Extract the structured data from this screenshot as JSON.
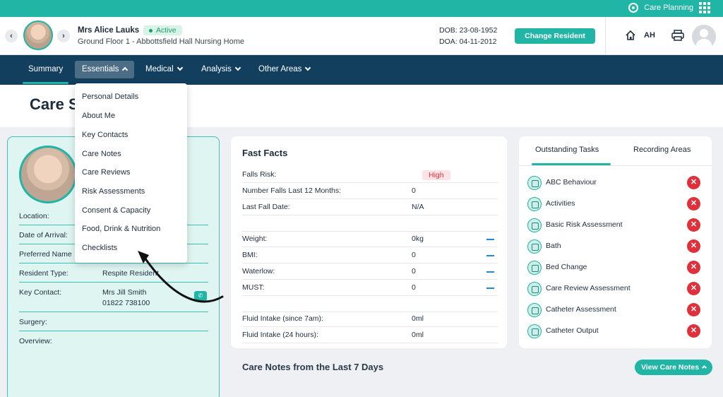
{
  "topbar": {
    "care_planning": "Care Planning"
  },
  "header": {
    "resident_name": "Mrs Alice Lauks",
    "status": "Active",
    "location": "Ground Floor 1 - Abbottsfield Hall Nursing Home",
    "dob": "DOB: 23-08-1952",
    "doa": "DOA: 04-11-2012",
    "change_button": "Change Resident",
    "user_initials": "AH"
  },
  "nav": {
    "items": [
      {
        "label": "Summary"
      },
      {
        "label": "Essentials"
      },
      {
        "label": "Medical"
      },
      {
        "label": "Analysis"
      },
      {
        "label": "Other Areas"
      }
    ]
  },
  "page": {
    "title": "Care S"
  },
  "essentials_menu": [
    "Personal Details",
    "About Me",
    "Key Contacts",
    "Care Notes",
    "Care Reviews",
    "Risk Assessments",
    "Consent & Capacity",
    "Food, Drink & Nutrition",
    "Checklists"
  ],
  "resident_card": {
    "fields": [
      {
        "label": "Location:",
        "value": ""
      },
      {
        "label": "Date of Arrival:",
        "value": ""
      },
      {
        "label": "Preferred Name",
        "value": ""
      },
      {
        "label": "Resident Type:",
        "value": "Respite Resident"
      },
      {
        "label": "Key Contact:",
        "value": "Mrs Jill Smith",
        "value2": "01822 738100"
      },
      {
        "label": "Surgery:",
        "value": ""
      },
      {
        "label": "Overview:",
        "value": ""
      }
    ]
  },
  "fast_facts": {
    "title": "Fast Facts",
    "rows": [
      {
        "label": "Falls Risk:",
        "value": "High"
      },
      {
        "label": "Number Falls Last 12 Months:",
        "value": "0"
      },
      {
        "label": "Last Fall Date:",
        "value": "N/A"
      },
      {
        "label": "Weight:",
        "value": "0kg"
      },
      {
        "label": "BMI:",
        "value": "0"
      },
      {
        "label": "Waterlow:",
        "value": "0"
      },
      {
        "label": "MUST:",
        "value": "0"
      },
      {
        "label": "Fluid Intake (since 7am):",
        "value": "0ml"
      },
      {
        "label": "Fluid Intake (24 hours):",
        "value": "0ml"
      }
    ]
  },
  "tasks": {
    "tab_outstanding": "Outstanding Tasks",
    "tab_recording": "Recording Areas",
    "items": [
      "ABC Behaviour",
      "Activities",
      "Basic Risk Assessment",
      "Bath",
      "Bed Change",
      "Care Review Assessment",
      "Catheter Assessment",
      "Catheter Output"
    ]
  },
  "care_notes": {
    "title": "Care Notes from the Last 7 Days",
    "button": "View Care Notes"
  },
  "colors": {
    "teal": "#20b5a5",
    "navy": "#133f5e",
    "red": "#e0303b"
  }
}
